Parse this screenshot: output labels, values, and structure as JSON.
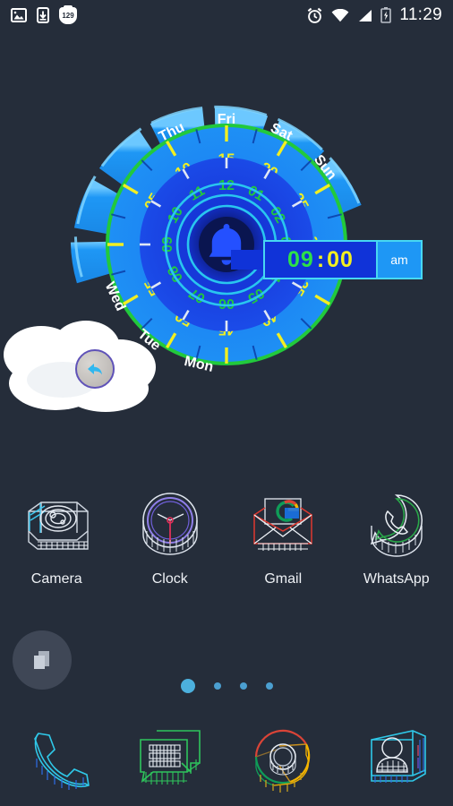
{
  "status_bar": {
    "icons_left": [
      "image-icon",
      "download-icon",
      "notification-badge-icon"
    ],
    "badge_count": "129",
    "icons_right": [
      "alarm-icon",
      "wifi-icon",
      "signal-icon",
      "battery-charging-icon"
    ],
    "time": "11:29"
  },
  "widget": {
    "name": "alarm-clock-widget",
    "days": [
      "Mon",
      "Tue",
      "Wed",
      "Thu",
      "Fri",
      "Sat",
      "Sun"
    ],
    "minute_ticks": [
      "15",
      "20",
      "25",
      "30",
      "35",
      "40",
      "45",
      "50",
      "55",
      "05",
      "10"
    ],
    "hour_ticks": [
      "12",
      "01",
      "02",
      "03",
      "04",
      "05",
      "06",
      "07",
      "08",
      "09",
      "10",
      "11"
    ],
    "center_icon": "bell-icon",
    "time_display": {
      "hours": "09",
      "separator": ":",
      "minutes": "00",
      "meridiem": "am"
    },
    "back_button_icon": "back-arrow-icon",
    "colors": {
      "minute_text": "#f2ef21",
      "hour_text": "#22c93c",
      "ring_outer": "#22c93c",
      "day_segment": "#1e97f5",
      "dial_inner": "#1330d2",
      "accent_cyan": "#47d8f2"
    }
  },
  "apps": [
    {
      "label": "Camera",
      "icon": "camera-icon"
    },
    {
      "label": "Clock",
      "icon": "clock-icon"
    },
    {
      "label": "Gmail",
      "icon": "gmail-icon"
    },
    {
      "label": "WhatsApp",
      "icon": "whatsapp-icon"
    }
  ],
  "fab": {
    "icon": "pages-switch-icon"
  },
  "page_indicator": {
    "total": 4,
    "active": 1
  },
  "dock": [
    {
      "icon": "phone-icon"
    },
    {
      "icon": "messages-icon"
    },
    {
      "icon": "chrome-icon"
    },
    {
      "icon": "contacts-icon"
    }
  ],
  "theme": {
    "background": "#252d3a"
  }
}
